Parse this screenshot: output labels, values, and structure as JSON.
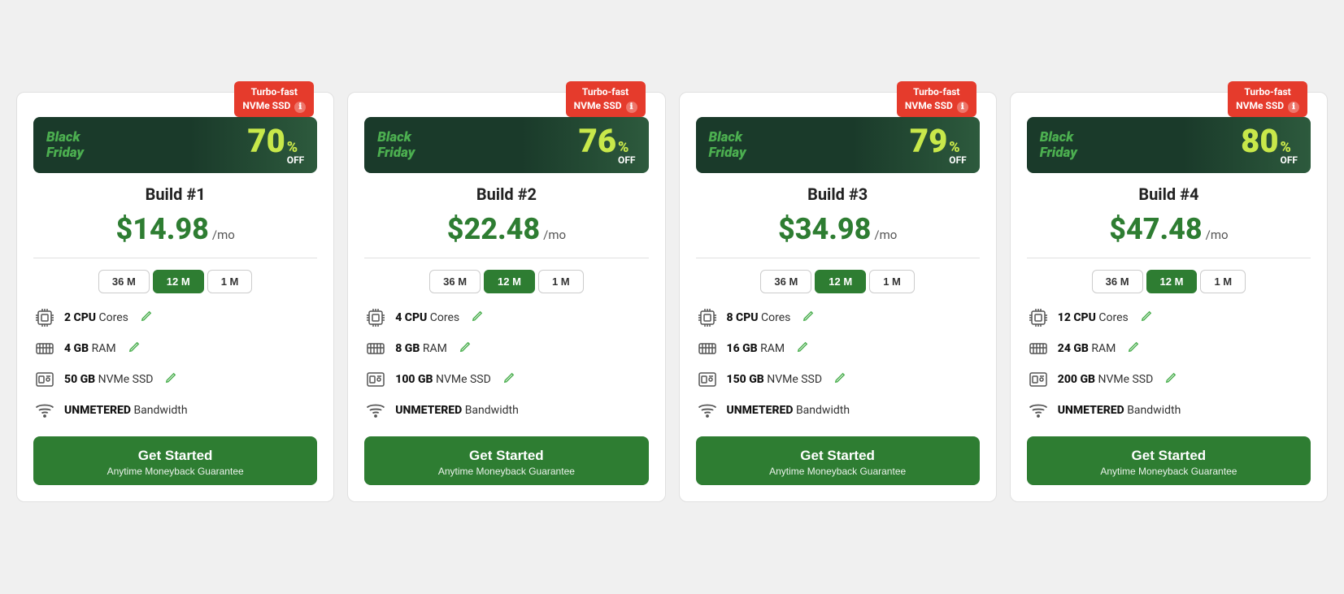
{
  "plans": [
    {
      "id": "build-1",
      "turbo_badge": "Turbo-fast\nNVMe SSD",
      "bf_discount": "70",
      "title": "Build #1",
      "price": "$14.98",
      "period": "/mo",
      "periods": [
        "36 M",
        "12 M",
        "1 M"
      ],
      "active_period": 1,
      "specs": [
        {
          "icon": "cpu",
          "bold": "2 CPU",
          "text": " Cores",
          "edit": true
        },
        {
          "icon": "ram",
          "bold": "4 GB",
          "text": " RAM",
          "edit": true
        },
        {
          "icon": "ssd",
          "bold": "50 GB",
          "text": " NVMe SSD",
          "edit": true
        },
        {
          "icon": "wifi",
          "bold": "UNMETERED",
          "text": " Bandwidth",
          "edit": false
        }
      ],
      "btn_main": "Get Started",
      "btn_sub": "Anytime Moneyback Guarantee"
    },
    {
      "id": "build-2",
      "turbo_badge": "Turbo-fast\nNVMe SSD",
      "bf_discount": "76",
      "title": "Build #2",
      "price": "$22.48",
      "period": "/mo",
      "periods": [
        "36 M",
        "12 M",
        "1 M"
      ],
      "active_period": 1,
      "specs": [
        {
          "icon": "cpu",
          "bold": "4 CPU",
          "text": " Cores",
          "edit": true
        },
        {
          "icon": "ram",
          "bold": "8 GB",
          "text": " RAM",
          "edit": true
        },
        {
          "icon": "ssd",
          "bold": "100 GB",
          "text": " NVMe SSD",
          "edit": true
        },
        {
          "icon": "wifi",
          "bold": "UNMETERED",
          "text": " Bandwidth",
          "edit": false
        }
      ],
      "btn_main": "Get Started",
      "btn_sub": "Anytime Moneyback Guarantee"
    },
    {
      "id": "build-3",
      "turbo_badge": "Turbo-fast\nNVMe SSD",
      "bf_discount": "79",
      "title": "Build #3",
      "price": "$34.98",
      "period": "/mo",
      "periods": [
        "36 M",
        "12 M",
        "1 M"
      ],
      "active_period": 1,
      "specs": [
        {
          "icon": "cpu",
          "bold": "8 CPU",
          "text": " Cores",
          "edit": true
        },
        {
          "icon": "ram",
          "bold": "16 GB",
          "text": " RAM",
          "edit": true
        },
        {
          "icon": "ssd",
          "bold": "150 GB",
          "text": " NVMe SSD",
          "edit": true
        },
        {
          "icon": "wifi",
          "bold": "UNMETERED",
          "text": " Bandwidth",
          "edit": false
        }
      ],
      "btn_main": "Get Started",
      "btn_sub": "Anytime Moneyback Guarantee"
    },
    {
      "id": "build-4",
      "turbo_badge": "Turbo-fast\nNVMe SSD",
      "bf_discount": "80",
      "title": "Build #4",
      "price": "$47.48",
      "period": "/mo",
      "periods": [
        "36 M",
        "12 M",
        "1 M"
      ],
      "active_period": 1,
      "specs": [
        {
          "icon": "cpu",
          "bold": "12 CPU",
          "text": " Cores",
          "edit": true
        },
        {
          "icon": "ram",
          "bold": "24 GB",
          "text": " RAM",
          "edit": true
        },
        {
          "icon": "ssd",
          "bold": "200 GB",
          "text": " NVMe SSD",
          "edit": true
        },
        {
          "icon": "wifi",
          "bold": "UNMETERED",
          "text": " Bandwidth",
          "edit": false
        }
      ],
      "btn_main": "Get Started",
      "btn_sub": "Anytime Moneyback Guarantee"
    }
  ]
}
